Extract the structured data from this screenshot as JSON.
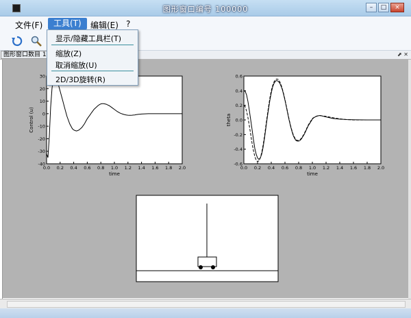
{
  "window": {
    "title": "图形窗口编号 100000"
  },
  "menu": {
    "file": "文件(F)",
    "tools": "工具(T)",
    "edit": "编辑(E)",
    "help": "?"
  },
  "tools_menu": {
    "show_hide_toolbar": "显示/隐藏工具栏(T)",
    "zoom": "缩放(Z)",
    "unzoom": "取消缩放(U)",
    "rotate_2d3d": "2D/3D旋转(R)"
  },
  "subwindow": {
    "title": "图形窗口数目 1"
  },
  "chart_data": [
    {
      "type": "line",
      "xlabel": "time",
      "ylabel": "Control (u)",
      "xlim": [
        0,
        2.0
      ],
      "ylim": [
        -40,
        30
      ],
      "xticks": [
        "0.0",
        "0.2",
        "0.4",
        "0.6",
        "0.8",
        "1.0",
        "1.2",
        "1.4",
        "1.6",
        "1.8",
        "2.0"
      ],
      "yticks": [
        "-40",
        "-30",
        "-20",
        "-10",
        "0",
        "10",
        "20",
        "30"
      ],
      "series": [
        {
          "x": [
            0,
            0.02,
            0.04,
            0.06,
            0.08,
            0.1,
            0.12,
            0.14,
            0.16,
            0.18,
            0.2,
            0.22,
            0.24,
            0.26,
            0.28,
            0.3,
            0.32,
            0.34,
            0.36,
            0.38,
            0.4,
            0.42,
            0.44,
            0.46,
            0.48,
            0.5,
            0.52,
            0.54,
            0.56,
            0.58,
            0.6,
            0.62,
            0.64,
            0.66,
            0.68,
            0.7,
            0.72,
            0.74,
            0.76,
            0.78,
            0.8,
            0.82,
            0.84,
            0.86,
            0.88,
            0.9,
            0.92,
            0.94,
            0.96,
            0.98,
            1.0,
            1.02,
            1.04,
            1.06,
            1.08,
            1.1,
            1.12,
            1.14,
            1.16,
            1.18,
            1.2,
            1.22,
            1.24,
            1.26,
            1.28,
            1.3,
            1.32,
            1.34,
            1.36,
            1.38,
            1.4,
            1.5,
            1.6,
            1.7,
            1.8,
            1.9,
            2.0
          ],
          "y": [
            -32,
            -35,
            -18,
            5,
            20,
            28,
            30,
            28,
            25,
            22,
            18,
            14,
            10,
            6,
            2,
            -2,
            -5,
            -8,
            -10,
            -12,
            -13,
            -13.5,
            -13.8,
            -13.5,
            -13,
            -12,
            -11,
            -9.5,
            -8,
            -6,
            -4,
            -2.5,
            -1,
            0.5,
            2,
            3.5,
            4.5,
            5.5,
            6.5,
            7.2,
            7.8,
            8,
            8,
            7.8,
            7.5,
            7,
            6.5,
            5.8,
            5,
            4.2,
            3.4,
            2.6,
            1.8,
            1.2,
            0.6,
            0.1,
            -0.3,
            -0.6,
            -0.9,
            -1.1,
            -1.2,
            -1.3,
            -1.3,
            -1.2,
            -1.1,
            -1,
            -0.8,
            -0.6,
            -0.5,
            -0.4,
            -0.3,
            0,
            0,
            0,
            0,
            0,
            0
          ]
        }
      ]
    },
    {
      "type": "line",
      "xlabel": "time",
      "ylabel": "theta",
      "xlim": [
        0,
        2.0
      ],
      "ylim": [
        -0.6,
        0.6
      ],
      "xticks": [
        "0.0",
        "0.2",
        "0.4",
        "0.6",
        "0.8",
        "1.0",
        "1.2",
        "1.4",
        "1.6",
        "1.8",
        "2.0"
      ],
      "yticks": [
        "-0.6",
        "-0.4",
        "-0.2",
        "0.0",
        "0.2",
        "0.4",
        "0.6"
      ],
      "series": [
        {
          "style": "solid",
          "x": [
            0,
            0.02,
            0.04,
            0.06,
            0.08,
            0.1,
            0.12,
            0.14,
            0.16,
            0.18,
            0.2,
            0.22,
            0.24,
            0.26,
            0.28,
            0.3,
            0.32,
            0.34,
            0.36,
            0.38,
            0.4,
            0.42,
            0.44,
            0.46,
            0.48,
            0.5,
            0.52,
            0.54,
            0.56,
            0.58,
            0.6,
            0.62,
            0.64,
            0.66,
            0.68,
            0.7,
            0.72,
            0.74,
            0.76,
            0.78,
            0.8,
            0.82,
            0.84,
            0.86,
            0.88,
            0.9,
            0.92,
            0.94,
            0.96,
            0.98,
            1.0,
            1.02,
            1.04,
            1.06,
            1.08,
            1.1,
            1.12,
            1.14,
            1.16,
            1.18,
            1.2,
            1.25,
            1.3,
            1.35,
            1.4,
            1.45,
            1.5,
            1.6,
            1.7,
            1.8,
            1.9,
            2.0
          ],
          "y": [
            0.4,
            0.39,
            0.34,
            0.25,
            0.13,
            0,
            -0.13,
            -0.27,
            -0.39,
            -0.47,
            -0.52,
            -0.54,
            -0.52,
            -0.47,
            -0.38,
            -0.26,
            -0.12,
            0.02,
            0.15,
            0.27,
            0.37,
            0.45,
            0.5,
            0.53,
            0.54,
            0.53,
            0.51,
            0.47,
            0.42,
            0.35,
            0.27,
            0.18,
            0.09,
            0,
            -0.08,
            -0.15,
            -0.21,
            -0.25,
            -0.28,
            -0.29,
            -0.29,
            -0.28,
            -0.26,
            -0.23,
            -0.2,
            -0.16,
            -0.12,
            -0.08,
            -0.05,
            -0.02,
            0.01,
            0.03,
            0.04,
            0.05,
            0.055,
            0.06,
            0.06,
            0.055,
            0.05,
            0.045,
            0.04,
            0.03,
            0.02,
            0.015,
            0.01,
            0.008,
            0.005,
            0.002,
            0.001,
            0,
            0,
            0
          ]
        },
        {
          "style": "dashed",
          "x": [
            0,
            0.02,
            0.04,
            0.06,
            0.08,
            0.1,
            0.12,
            0.14,
            0.16,
            0.18,
            0.2,
            0.22,
            0.24,
            0.26,
            0.28,
            0.3,
            0.32,
            0.34,
            0.36,
            0.38,
            0.4,
            0.42,
            0.44,
            0.46,
            0.48,
            0.5,
            0.52,
            0.54,
            0.56,
            0.58,
            0.6,
            0.62,
            0.64,
            0.66,
            0.68,
            0.7,
            0.72,
            0.74,
            0.76,
            0.78,
            0.8,
            0.82,
            0.84,
            0.86,
            0.88,
            0.9,
            0.92,
            0.94,
            0.96,
            0.98,
            1.0,
            1.05,
            1.1,
            1.2,
            1.3,
            1.4,
            1.5,
            1.6,
            1.8,
            2.0
          ],
          "y": [
            0.2,
            0.18,
            0.12,
            0.03,
            -0.08,
            -0.2,
            -0.32,
            -0.42,
            -0.5,
            -0.55,
            -0.57,
            -0.56,
            -0.52,
            -0.45,
            -0.35,
            -0.23,
            -0.09,
            0.05,
            0.18,
            0.3,
            0.4,
            0.47,
            0.52,
            0.55,
            0.56,
            0.555,
            0.53,
            0.49,
            0.43,
            0.36,
            0.28,
            0.19,
            0.1,
            0.01,
            -0.07,
            -0.14,
            -0.2,
            -0.24,
            -0.27,
            -0.28,
            -0.28,
            -0.27,
            -0.25,
            -0.22,
            -0.19,
            -0.15,
            -0.11,
            -0.07,
            -0.04,
            -0.01,
            0.02,
            0.05,
            0.06,
            0.05,
            0.03,
            0.015,
            0.005,
            0,
            0,
            0
          ]
        }
      ]
    }
  ]
}
